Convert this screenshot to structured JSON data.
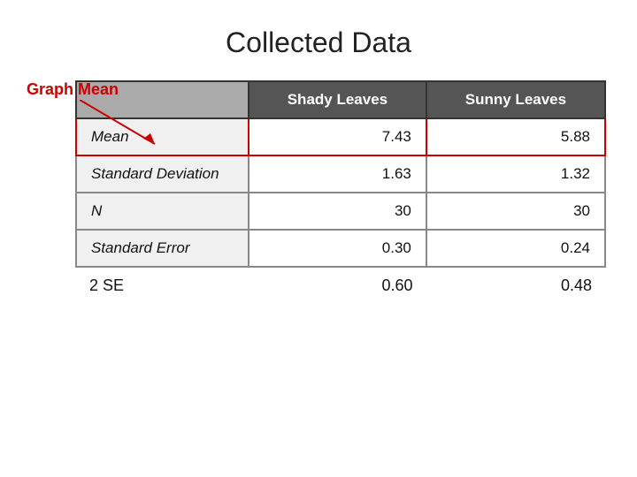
{
  "title": "Collected Data",
  "label_graph_mean": "Graph Mean",
  "table": {
    "headers": [
      "",
      "Shady Leaves",
      "Sunny Leaves"
    ],
    "rows": [
      {
        "label": "Mean",
        "shady": "7.43",
        "sunny": "5.88",
        "highlight": true
      },
      {
        "label": "Standard Deviation",
        "shady": "1.63",
        "sunny": "1.32",
        "highlight": false
      },
      {
        "label": "N",
        "shady": "30",
        "sunny": "30",
        "highlight": false
      },
      {
        "label": "Standard Error",
        "shady": "0.30",
        "sunny": "0.24",
        "highlight": false
      }
    ]
  },
  "footer": {
    "label": "2 SE",
    "shady": "0.60",
    "sunny": "0.48"
  }
}
